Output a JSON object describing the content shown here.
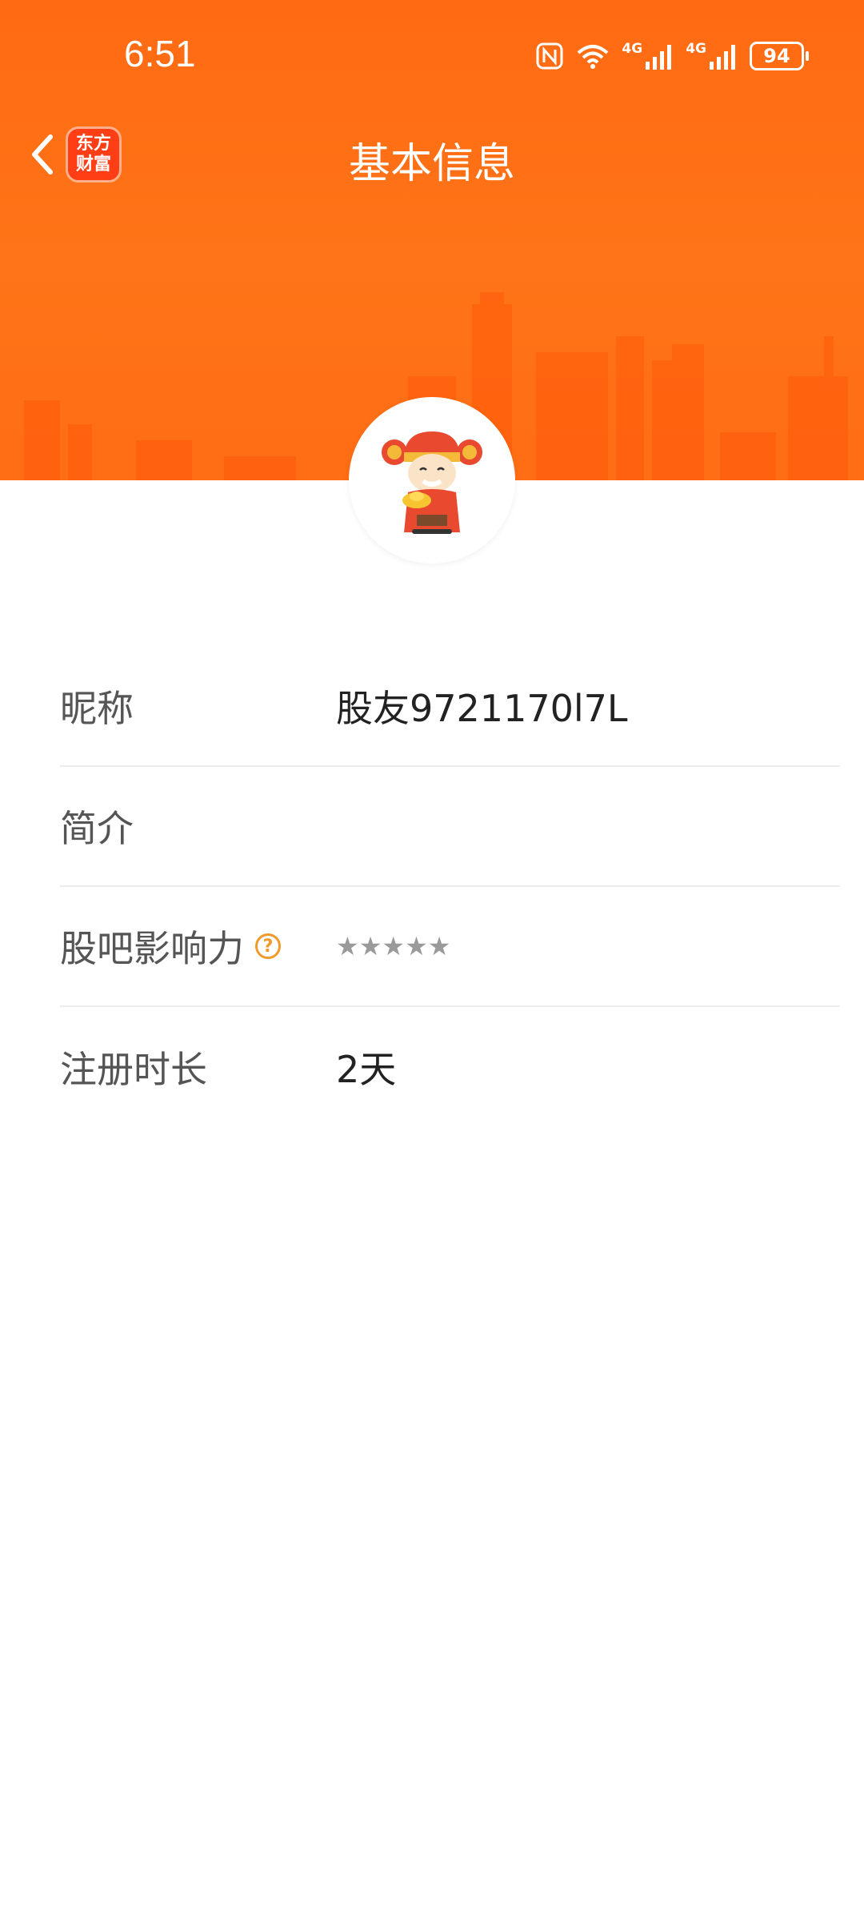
{
  "status_bar": {
    "time": "6:51",
    "battery": "94",
    "net_1": "4G",
    "net_2": "4G",
    "icons": [
      "nfc-icon",
      "wifi-icon",
      "signal-icon",
      "signal-icon",
      "battery-icon"
    ]
  },
  "header": {
    "title": "基本信息",
    "logo_line1": "东方",
    "logo_line2": "财富",
    "accent_color": "#ff6a12"
  },
  "info": {
    "nickname_label": "昵称",
    "nickname_value": "股友9721170l7L",
    "intro_label": "简介",
    "intro_value": "",
    "influence_label": "股吧影响力",
    "influence_help": "?",
    "influence_stars": "★★★★★",
    "register_label": "注册时长",
    "register_value": "2天"
  }
}
